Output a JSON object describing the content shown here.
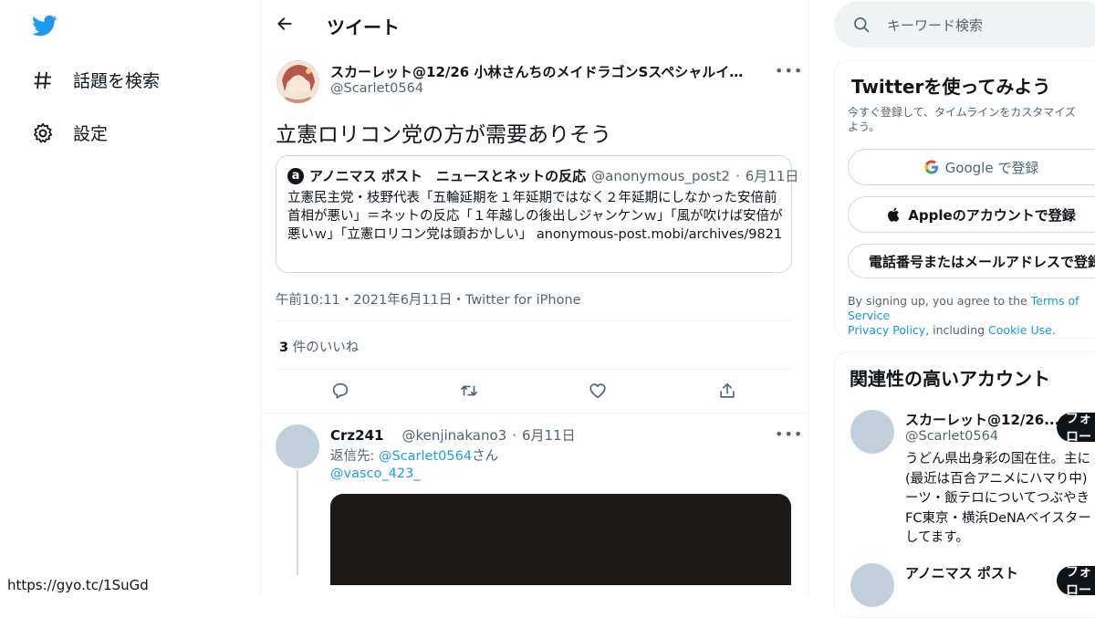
{
  "nav": {
    "explore_label": "話題を検索",
    "settings_label": "設定"
  },
  "header": {
    "title": "ツイート"
  },
  "tweet": {
    "author_name": "スカーレット@12/26 小林さんちのメイドラゴンSスペシャルイベ…",
    "handle": "@Scarlet0564",
    "text": "立憲ロリコン党の方が需要ありそう",
    "quote": {
      "author_name": "アノニマス ポスト　ニュースとネットの反応",
      "handle": "@anonymous_post2",
      "date": "6月11日",
      "body": "立憲民主党・枝野代表「五輪延期を１年延期ではなく２年延期にしなかった安倍前首相が悪い」＝ネットの反応「１年越しの後出しジャンケンｗ」「風が吹けば安倍が悪いｗ」「立憲ロリコン党は頭おかしい」 anonymous-post.mobi/archives/9821"
    },
    "timestamp": "午前10:11・2021年6月11日・Twitter for iPhone",
    "likes_count": "3",
    "likes_label": " 件のいいね"
  },
  "reply": {
    "author_name": "Crz241",
    "handle": "@kenjinakano3",
    "date": "6月11日",
    "reply_to_prefix": "返信先: ",
    "reply_to_user1": "@Scarlet0564",
    "reply_to_suffix": "さん",
    "reply_to_user2": "@vasco_423_"
  },
  "search": {
    "placeholder": "キーワード検索"
  },
  "signup": {
    "title": "Twitterを使ってみよう",
    "subtitle_line1": "今すぐ登録して、タイムラインをカスタマイズ",
    "subtitle_line2": "よう。",
    "google_label": "Google で登録",
    "apple_label": "Appleのアカウントで登録",
    "phone_label": "電話番号またはメールアドレスで登録",
    "terms_prefix": "By signing up, you agree to the ",
    "terms_link": "Terms of Service",
    "privacy_link": "Privacy Policy",
    "including": ", including ",
    "cookie_link": "Cookie Use",
    "period": "."
  },
  "related": {
    "title": "関連性の高いアカウント",
    "accounts": [
      {
        "name": "スカーレット@12/26...",
        "handle": "@Scarlet0564",
        "follow_label": "フォロー",
        "bio_lines": [
          "うどん県出身彩の国在住。主に",
          "(最近は百合アニメにハマり中)",
          "ーツ・飯テロについてつぶやき",
          "FC東京・横浜DeNAベイスター",
          "してます。"
        ]
      },
      {
        "name": "アノニマス ポスト",
        "follow_label": "フォロー"
      }
    ]
  },
  "status_bar": {
    "url": "https://gyo.tc/1SuGd"
  },
  "colors": {
    "accent": "#1d9bf0",
    "text": "#0f1419",
    "muted": "#536471",
    "border": "#eff3f4"
  }
}
